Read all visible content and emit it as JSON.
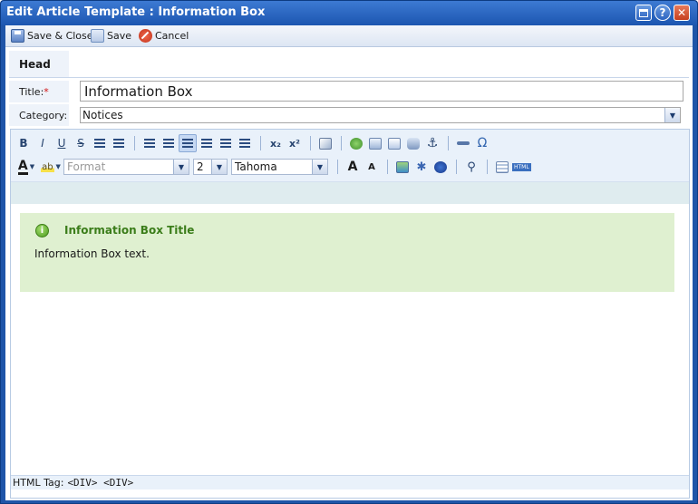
{
  "window": {
    "title": "Edit Article Template : Information Box",
    "help_glyph": "?",
    "close_glyph": "✕"
  },
  "actions": {
    "save_close": "Save & Close",
    "save": "Save",
    "cancel": "Cancel"
  },
  "form": {
    "tab_head": "Head",
    "title_label": "Title:",
    "title_required": "*",
    "title_value": "Information Box",
    "category_label": "Category:",
    "category_value": "Notices"
  },
  "toolbar": {
    "bold": "B",
    "italic": "I",
    "underline": "U",
    "strike": "S",
    "subscript": "x₂",
    "superscript": "x²",
    "omega": "Ω",
    "highlight": "ab",
    "font_color": "A",
    "format_placeholder": "Format",
    "font_size": "2",
    "font_name": "Tahoma",
    "grow_font": "A",
    "shrink_font": "A",
    "html": "HTML"
  },
  "content": {
    "info_icon": "i",
    "info_title": "Information Box Title",
    "info_text": "Information Box text."
  },
  "status": {
    "label": "HTML Tag:",
    "tags": "<DIV> <DIV>"
  },
  "colors": {
    "title_bar": "#1c56b0",
    "info_bg": "#dff0d0",
    "info_title": "#3b7d1a",
    "required": "#d01010"
  }
}
